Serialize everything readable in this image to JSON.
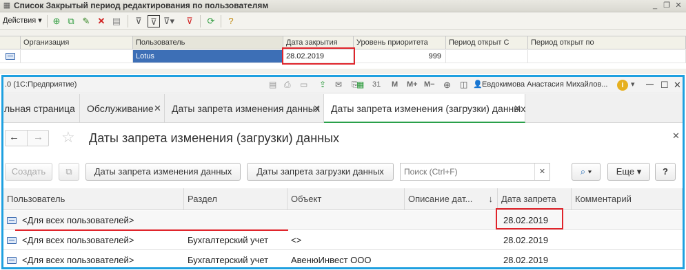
{
  "old_window": {
    "title": "Список Закрытый период редактирования по пользователям",
    "menu_label": "Действия",
    "columns": [
      "Организация",
      "Пользователь",
      "Дата закрытия",
      "Уровень приоритета",
      "Период открыт С",
      "Период открыт по"
    ],
    "row": {
      "org": "",
      "user": "Lotus",
      "date": "28.02.2019",
      "priority": "999",
      "from": "",
      "to": ""
    }
  },
  "new_window": {
    "title": ".0  (1С:Предприятие)",
    "user_name": "Евдокимова Анастасия Михайлов...",
    "tabs": [
      {
        "label": "льная страница"
      },
      {
        "label": "Обслуживание"
      },
      {
        "label": "Даты запрета изменения данных"
      },
      {
        "label": "Даты запрета изменения (загрузки) данных"
      }
    ],
    "page_title": "Даты запрета изменения (загрузки) данных",
    "buttons": {
      "create": "Создать",
      "btn1": "Даты запрета изменения данных",
      "btn2": "Даты запрета загрузки данных",
      "more": "Еще",
      "help": "?"
    },
    "search": {
      "placeholder": "Поиск (Ctrl+F)"
    },
    "columns": [
      "Пользователь",
      "Раздел",
      "Объект",
      "Описание дат...",
      "Дата запрета",
      "Комментарий"
    ],
    "rows": [
      {
        "user": "<Для всех пользователей>",
        "section": "",
        "object": "",
        "desc": "",
        "date": "28.02.2019",
        "comment": ""
      },
      {
        "user": "<Для всех пользователей>",
        "section": "Бухгалтерский учет",
        "object": "<>",
        "desc": "",
        "date": "28.02.2019",
        "comment": ""
      },
      {
        "user": "<Для всех пользователей>",
        "section": "Бухгалтерский учет",
        "object": "АвенюИнвест ООО",
        "desc": "",
        "date": "28.02.2019",
        "comment": ""
      }
    ]
  },
  "colors": {
    "highlight": "#e0242b",
    "frame": "#1ea0e0",
    "active_tab": "#2aa04a"
  }
}
